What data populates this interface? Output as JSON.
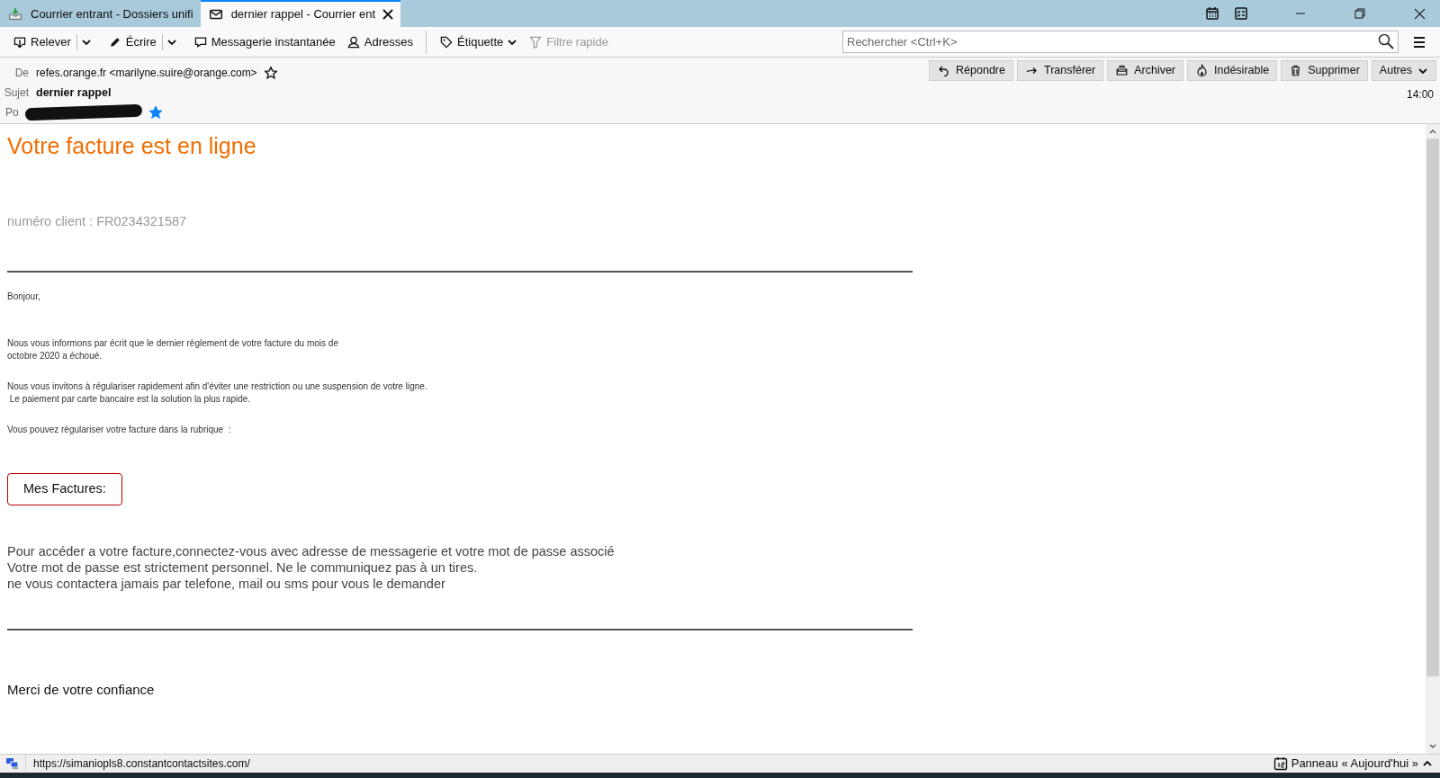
{
  "tabs": [
    {
      "label": "Courrier entrant - Dossiers unifi",
      "kind": "inbox",
      "selected": false
    },
    {
      "label": "dernier rappel - Courrier ent",
      "kind": "message",
      "selected": true
    }
  ],
  "toolbar": {
    "buttons": [
      {
        "label": "Relever",
        "kind": "get",
        "menu": true
      },
      {
        "label": "Écrire",
        "kind": "write",
        "menu": true
      },
      {
        "label": "Messagerie instantanée",
        "kind": "chat",
        "menu": false
      },
      {
        "label": "Adresses",
        "kind": "contacts",
        "menu": false
      },
      {
        "label": "Étiquette",
        "kind": "tag",
        "menu": true
      },
      {
        "label": "Filtre rapide",
        "kind": "filter",
        "menu": false,
        "disabled": true
      }
    ],
    "search": {
      "placeholder": "Rechercher <Ctrl+K>"
    }
  },
  "header": {
    "fields": [
      {
        "label": "De",
        "value": "refes.orange.fr <marilyne.suire@orange.com>",
        "starred": false,
        "redacted": false
      },
      {
        "label": "Sujet",
        "value": "dernier rappel",
        "bold": true
      },
      {
        "label": "Po",
        "starred": true,
        "redacted": true
      }
    ],
    "actions": [
      {
        "label": "Répondre",
        "kind": "reply"
      },
      {
        "label": "Transférer",
        "kind": "forward"
      },
      {
        "label": "Archiver",
        "kind": "archive"
      },
      {
        "label": "Indésirable",
        "kind": "junk"
      },
      {
        "label": "Supprimer",
        "kind": "delete"
      },
      {
        "label": "Autres",
        "kind": "more"
      }
    ],
    "time": "14:00"
  },
  "message": {
    "title": "Votre facture est en ligne",
    "client": "numéro client : FR0234321587",
    "greeting": "Bonjour,",
    "paragraphs": [
      [
        "Nous vous informons par écrit que le dernier règlement de votre facture du mois de",
        "octobre 2020 a échoué."
      ],
      [
        "Nous vous invitons à régulariser rapidement afin d'éviter une restriction ou une suspension de votre ligne.",
        " Le paiement par carte bancaire est la solution la plus rapide."
      ],
      [
        "Vous pouvez régulariser votre facture dans la rubrique  :"
      ]
    ],
    "button": "Mes Factures:",
    "notice": [
      "Pour accéder a votre facture,connectez-vous avec adresse de messagerie et votre mot de passe associé",
      "Votre mot de passe est strictement personnel. Ne le communiquez pas à un tires.",
      "ne vous contactera jamais par telefone, mail ou sms pour vous le demander"
    ],
    "closing": "Merci de votre confiance"
  },
  "status_bar": {
    "url": "https://simaniopls8.constantcontactsites.com/",
    "today_pane": "Panneau « Aujourd'hui »"
  }
}
